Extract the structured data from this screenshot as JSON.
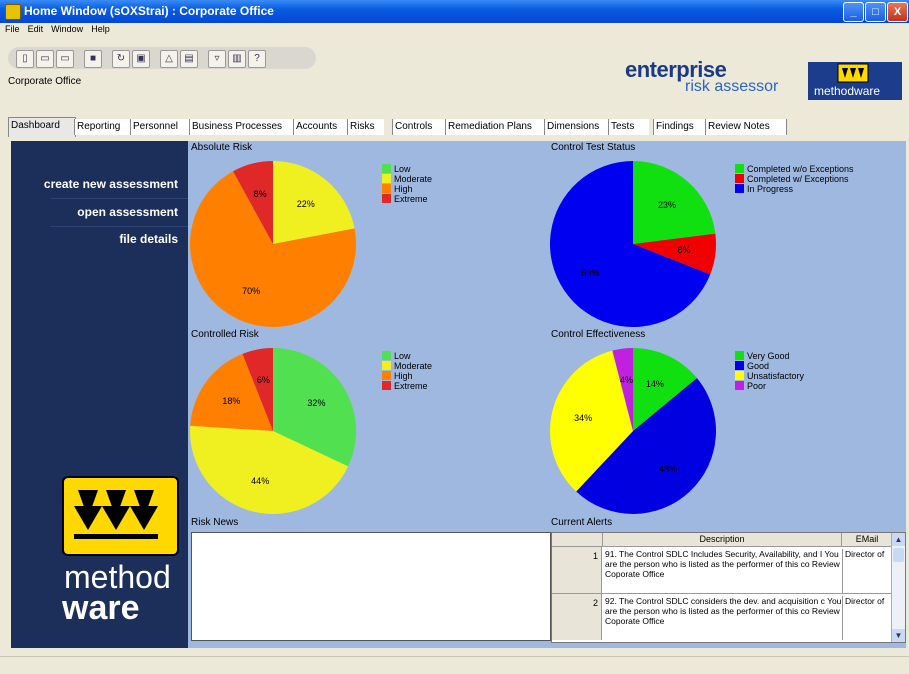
{
  "window": {
    "title": "Home Window (sOXStrai) : Corporate Office",
    "minimize": "_",
    "maximize": "□",
    "close": "X"
  },
  "menu": [
    "File",
    "Edit",
    "Window",
    "Help"
  ],
  "toolbar_help": "?",
  "org_label": "Corporate Office",
  "brand": {
    "line1": "enterprise",
    "line2": "risk assessor",
    "logo_text": "methodware"
  },
  "tabs": [
    "Dashboard",
    "Reporting",
    "Personnel",
    "Business Processes",
    "Accounts",
    "Risks",
    "Controls",
    "Remediation Plans",
    "Dimensions",
    "Tests",
    "Findings",
    "Review Notes"
  ],
  "sidebar": {
    "items": [
      "create new assessment",
      "open assessment",
      "file details"
    ],
    "logo_line1": "method",
    "logo_line2": "ware"
  },
  "panels": {
    "absolute_risk": "Absolute Risk",
    "control_test_status": "Control Test Status",
    "controlled_risk": "Controlled Risk",
    "control_effectiveness": "Control Effectiveness",
    "risk_news": "Risk News",
    "current_alerts": "Current Alerts"
  },
  "chart_data": [
    {
      "type": "pie",
      "title": "Absolute Risk",
      "categories": [
        "Low",
        "Moderate",
        "High",
        "Extreme"
      ],
      "values": [
        0,
        22,
        70,
        8
      ],
      "labels": [
        "",
        "22%",
        "70%",
        "8%"
      ],
      "colors": [
        "#50e050",
        "#f0f020",
        "#ff8000",
        "#e02828"
      ]
    },
    {
      "type": "pie",
      "title": "Control Test Status",
      "categories": [
        "Completed w/o Exceptions",
        "Completed w/ Exceptions",
        "In Progress"
      ],
      "values": [
        23,
        8,
        69
      ],
      "labels": [
        "23%",
        "8%",
        "69%"
      ],
      "colors": [
        "#10e010",
        "#f00000",
        "#0000f0"
      ]
    },
    {
      "type": "pie",
      "title": "Controlled Risk",
      "categories": [
        "Low",
        "Moderate",
        "High",
        "Extreme"
      ],
      "values": [
        32,
        44,
        18,
        6
      ],
      "labels": [
        "32%",
        "44%",
        "18%",
        "6%"
      ],
      "colors": [
        "#50e050",
        "#f0f020",
        "#ff8000",
        "#e02828"
      ]
    },
    {
      "type": "pie",
      "title": "Control Effectiveness",
      "categories": [
        "Very Good",
        "Good",
        "Unsatisfactory",
        "Poor"
      ],
      "values": [
        14,
        48,
        34,
        4
      ],
      "labels": [
        "14%",
        "48%",
        "34%",
        "4%"
      ],
      "colors": [
        "#10e010",
        "#0000e0",
        "#ffff00",
        "#c020e0"
      ]
    }
  ],
  "alerts": {
    "columns": [
      "",
      "Description",
      "EMail"
    ],
    "rows": [
      {
        "num": "1",
        "description": "91. The Control SDLC Includes Security, Availability, and I You are the person who is listed as the performer of this co Review Coporate Office",
        "email": "Director of"
      },
      {
        "num": "2",
        "description": "92. The Control SDLC considers the dev. and acquisition c You are the person who is listed as the performer of this co Review Coporate Office",
        "email": "Director of"
      }
    ]
  }
}
